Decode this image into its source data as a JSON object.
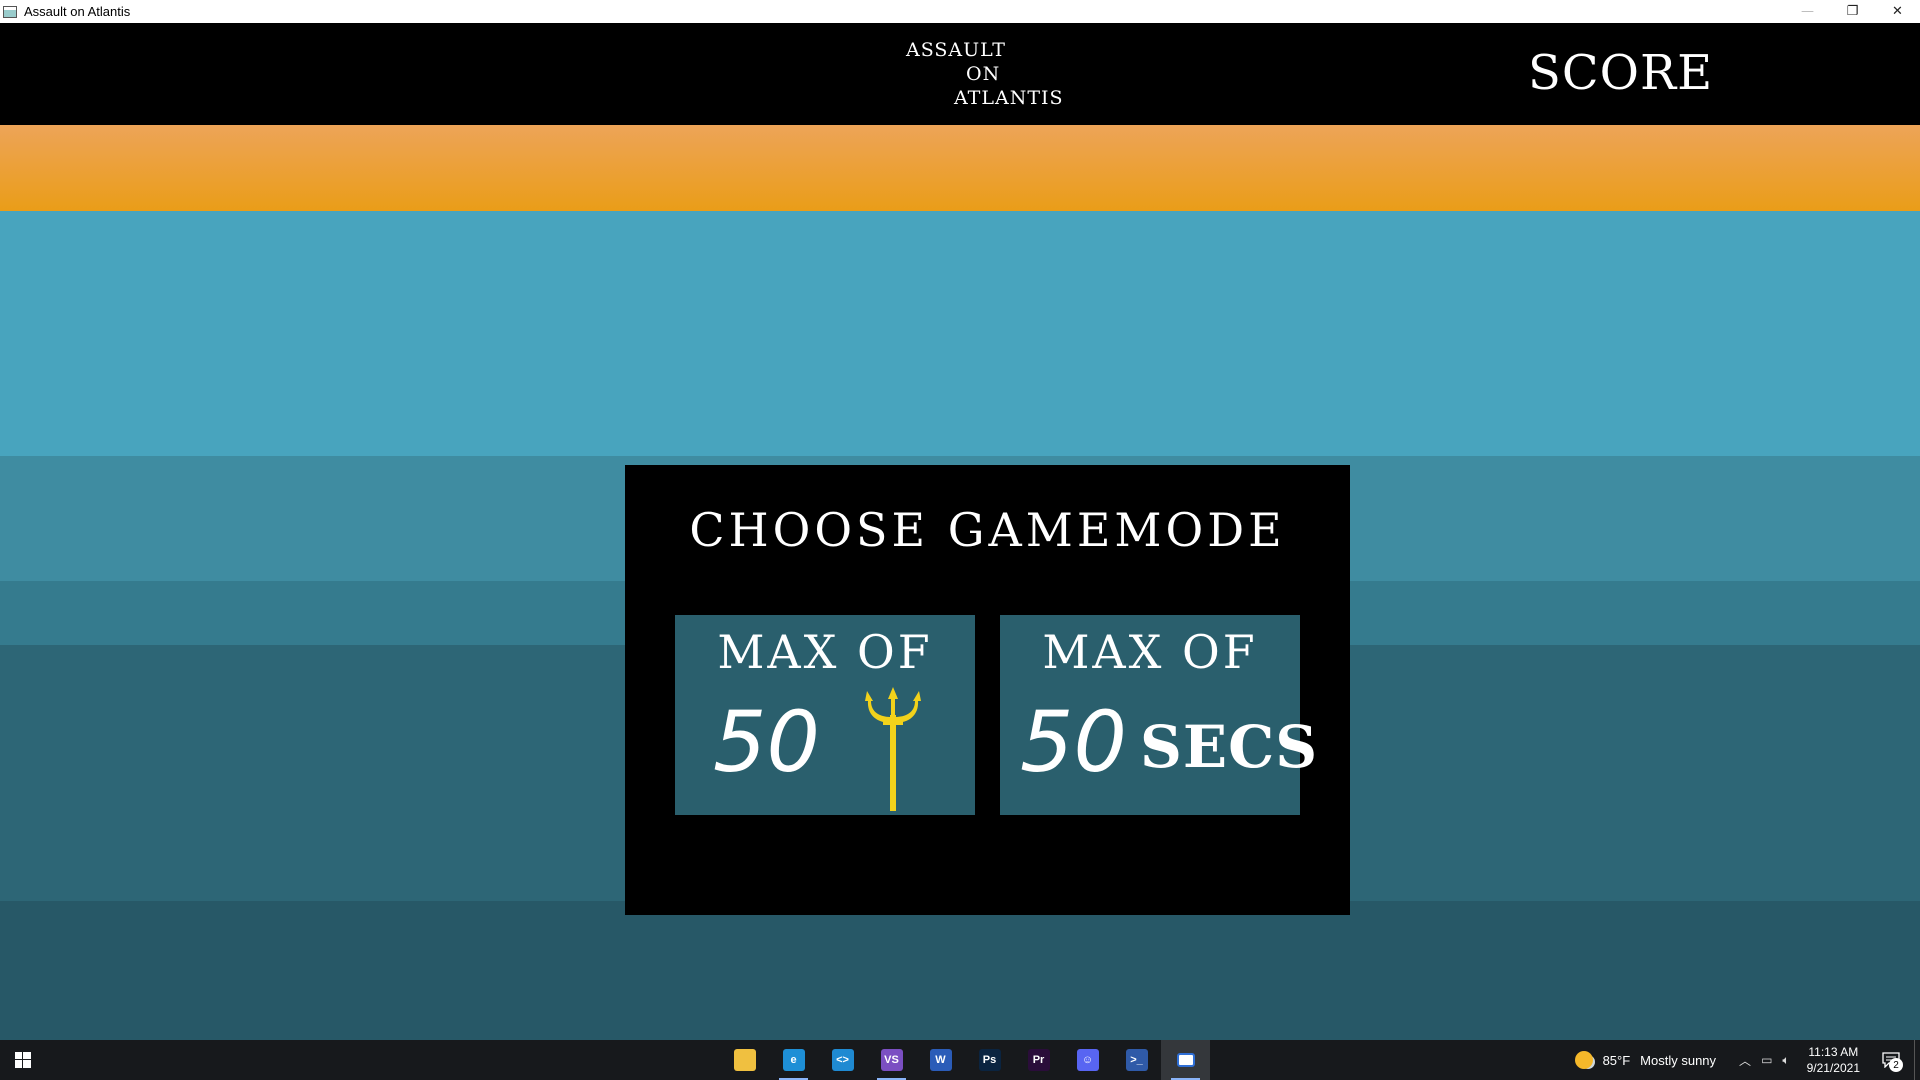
{
  "window": {
    "title": "Assault on Atlantis",
    "controls": {
      "minimize": "—",
      "restore": "❐",
      "close": "✕"
    }
  },
  "header": {
    "logo_lines": [
      "ASSAULT",
      "ON",
      "ATLANTIS"
    ],
    "score_label": "SCORE"
  },
  "dialog": {
    "title": "CHOOSE GAMEMODE",
    "modes": [
      {
        "top": "MAX OF",
        "number": "50",
        "unit_icon": "trident-icon",
        "color_icon": "#f2d21b"
      },
      {
        "top": "MAX OF",
        "number": "50",
        "unit": "SECS"
      }
    ]
  },
  "scene_colors": {
    "sunset_top": "#eda458",
    "sunset_bottom": "#ea9d18",
    "sea": [
      "#48a4be",
      "#3f8ca1",
      "#357b8e",
      "#2d6676",
      "#275867"
    ],
    "panel": "#2a5f6d"
  },
  "taskbar": {
    "apps": [
      {
        "name": "file-explorer-icon",
        "glyph": "",
        "color": "#f0c040",
        "running": false
      },
      {
        "name": "edge-icon",
        "glyph": "e",
        "color": "#1e8fd6",
        "running": true
      },
      {
        "name": "vscode-icon",
        "glyph": "<>",
        "color": "#1f8ad2",
        "running": false
      },
      {
        "name": "visual-studio-icon",
        "glyph": "VS",
        "color": "#7b4fc2",
        "running": true
      },
      {
        "name": "word-icon",
        "glyph": "W",
        "color": "#2b5cb8",
        "running": false
      },
      {
        "name": "photoshop-icon",
        "glyph": "Ps",
        "color": "#0b2440",
        "running": false
      },
      {
        "name": "premiere-icon",
        "glyph": "Pr",
        "color": "#2a0d3a",
        "running": false
      },
      {
        "name": "discord-icon",
        "glyph": "☺",
        "color": "#5865f2",
        "running": false
      },
      {
        "name": "powershell-icon",
        "glyph": ">_",
        "color": "#2f5aa8",
        "running": false
      },
      {
        "name": "game-window-icon",
        "glyph": "",
        "color": "#ffffff",
        "running": true,
        "active": true
      }
    ],
    "weather": {
      "temp": "85°F",
      "condition": "Mostly sunny"
    },
    "clock": {
      "time": "11:13 AM",
      "date": "9/21/2021"
    },
    "notification_count": "2"
  }
}
